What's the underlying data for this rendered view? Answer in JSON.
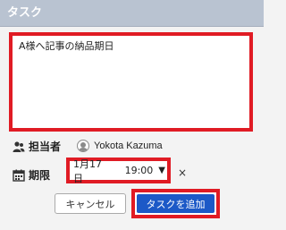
{
  "header": {
    "title": "タスク"
  },
  "task": {
    "text": "A様へ記事の納品期日"
  },
  "assignee": {
    "icon": "users-icon",
    "label": "担当者",
    "avatar_icon": "user-avatar-icon",
    "name": "Yokota Kazuma"
  },
  "due": {
    "icon": "calendar-icon",
    "label": "期限",
    "date": "1月17日",
    "time": "19:00",
    "caret": "▼",
    "clear": "×"
  },
  "actions": {
    "cancel_label": "キャンセル",
    "add_label": "タスクを追加"
  },
  "colors": {
    "header_bg": "#b9c3d1",
    "highlight": "#e01b24",
    "primary_button": "#1c59c7"
  }
}
